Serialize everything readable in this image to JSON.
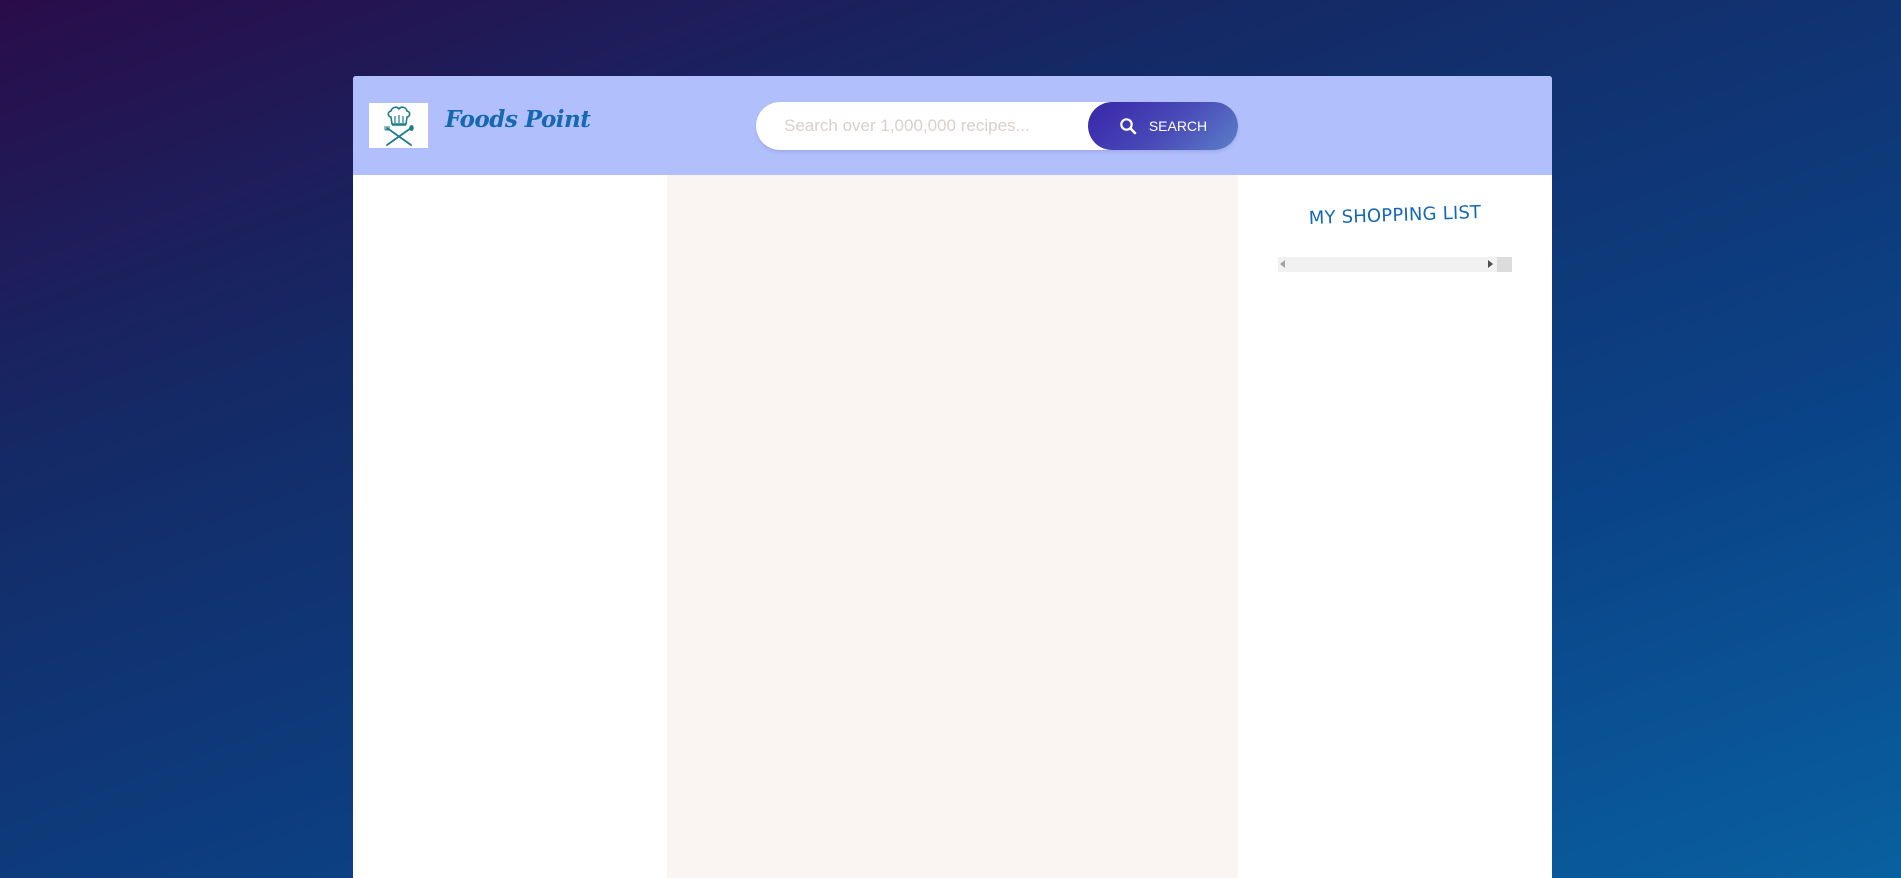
{
  "header": {
    "brand": "Foods Point",
    "logo_icon": "chef-hat-cutlery-icon"
  },
  "search": {
    "placeholder": "Search over 1,000,000 recipes...",
    "value": "",
    "button_label": "SEARCH",
    "button_icon": "search-icon"
  },
  "shopping_list": {
    "title": "MY SHOPPING LIST"
  },
  "colors": {
    "header_bg": "#b1bffc",
    "brand_text": "#1668b0",
    "button_gradient_start": "#3726a8",
    "button_gradient_end": "#5b80c8",
    "recipe_panel_bg": "#faf4f2"
  }
}
